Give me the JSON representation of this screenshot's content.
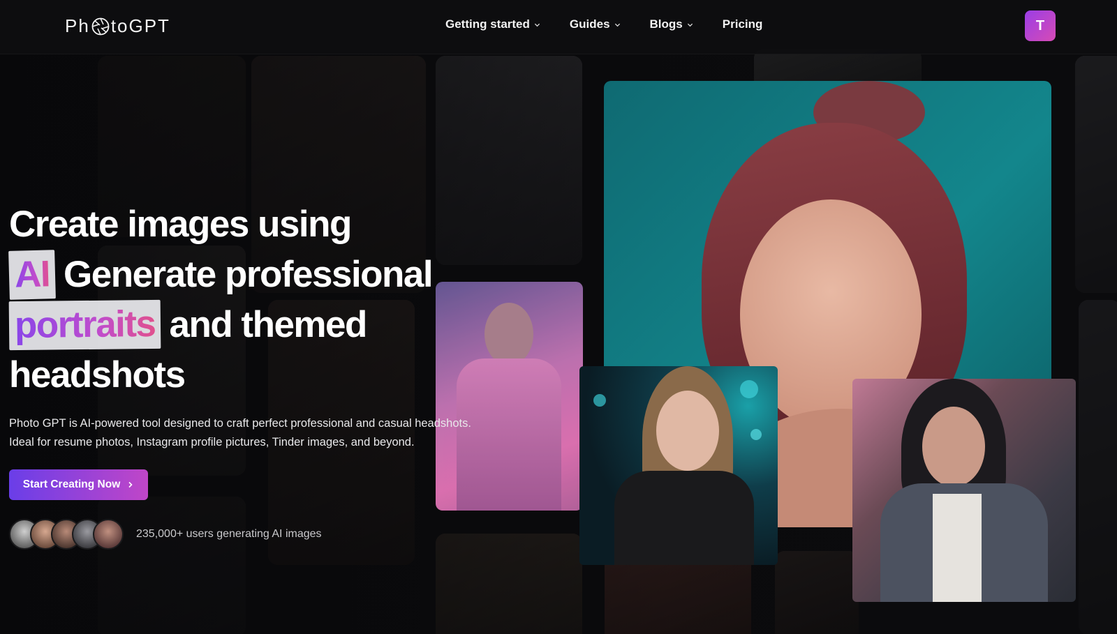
{
  "brand": {
    "logo_text_left": "Ph",
    "logo_text_right": "toGPT",
    "accent": "#9b3ee6",
    "accent_2": "#d64bb5"
  },
  "nav": {
    "items": [
      {
        "label": "Getting started",
        "has_dropdown": true
      },
      {
        "label": "Guides",
        "has_dropdown": true
      },
      {
        "label": "Blogs",
        "has_dropdown": true
      },
      {
        "label": "Pricing",
        "has_dropdown": false
      }
    ],
    "avatar_initial": "T"
  },
  "hero": {
    "line1": "Create images using",
    "highlight1": "AI",
    "line2_rest": "Generate professional",
    "highlight2": "portraits",
    "line3_rest": "and themed",
    "line4": "headshots",
    "subtext_line1": "Photo GPT is AI-powered tool designed to craft perfect professional and casual headshots.",
    "subtext_line2": "Ideal for resume photos, Instagram profile pictures, Tinder images, and beyond.",
    "cta_label": "Start Creating Now",
    "social_proof": "235,000+ users generating AI images"
  }
}
